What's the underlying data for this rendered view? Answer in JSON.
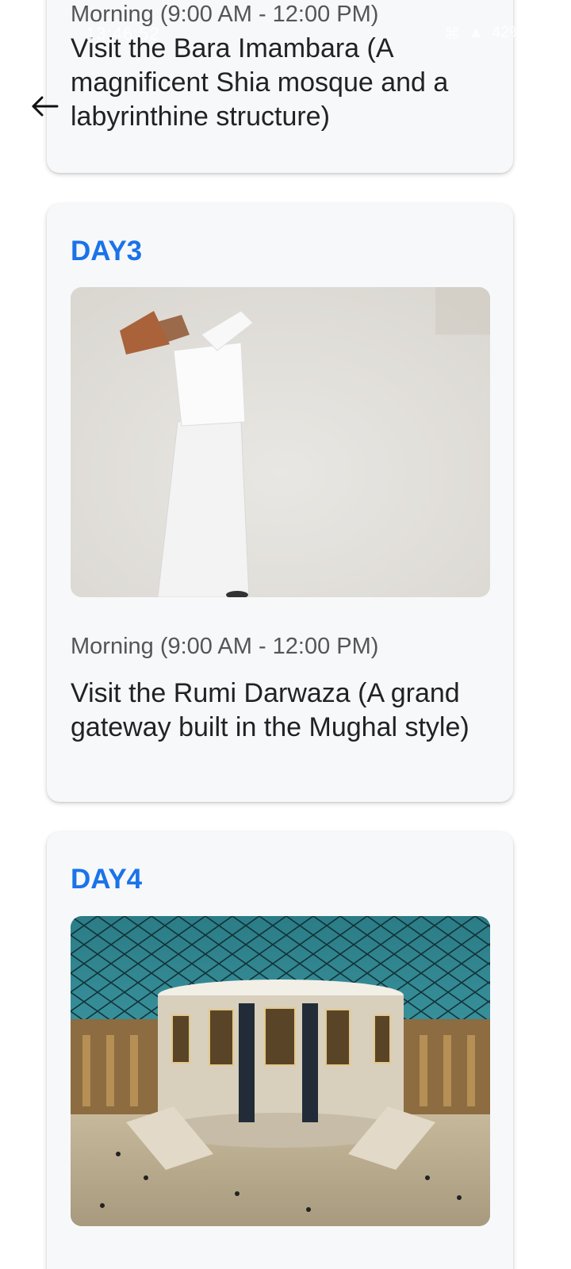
{
  "status_bar": {
    "time": "13:46:52",
    "battery": "42%"
  },
  "navigation": {
    "back_icon": "arrow-left-icon"
  },
  "itinerary": [
    {
      "day": "",
      "time": "Morning (9:00 AM - 12:00 PM)",
      "activity": "Visit the Bara Imambara (A magnificent Shia mosque and a labyrinthine structure)"
    },
    {
      "day": "DAY3",
      "time": "Morning (9:00 AM - 12:00 PM)",
      "activity": "Visit the Rumi Darwaza (A grand gateway built in the Mughal style)"
    },
    {
      "day": "DAY4"
    }
  ],
  "colors": {
    "day_title": "#1a73e8",
    "card_bg": "#f7f8fa"
  }
}
